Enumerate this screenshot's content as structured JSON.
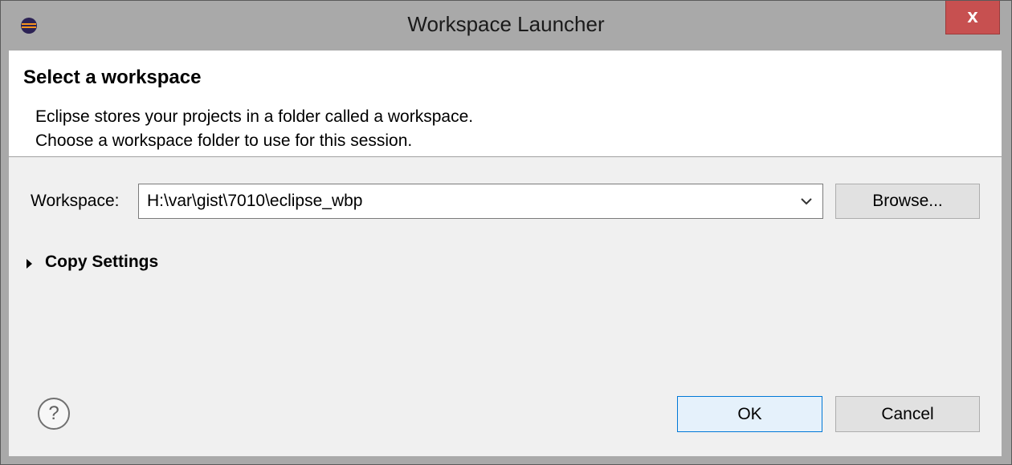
{
  "window": {
    "title": "Workspace Launcher",
    "close_glyph": "x",
    "app_icon": "eclipse-icon"
  },
  "header": {
    "title": "Select a workspace",
    "description_line1": "Eclipse stores your projects in a folder called a workspace.",
    "description_line2": "Choose a workspace folder to use for this session."
  },
  "workspace": {
    "label": "Workspace:",
    "value": "H:\\var\\gist\\7010\\eclipse_wbp",
    "browse_label": "Browse..."
  },
  "copy_settings": {
    "label": "Copy Settings",
    "expanded": false
  },
  "footer": {
    "help_glyph": "?",
    "ok_label": "OK",
    "cancel_label": "Cancel"
  },
  "colors": {
    "close_button": "#c75050",
    "ok_button_border": "#0078d7",
    "ok_button_fill": "#e5f1fb"
  }
}
